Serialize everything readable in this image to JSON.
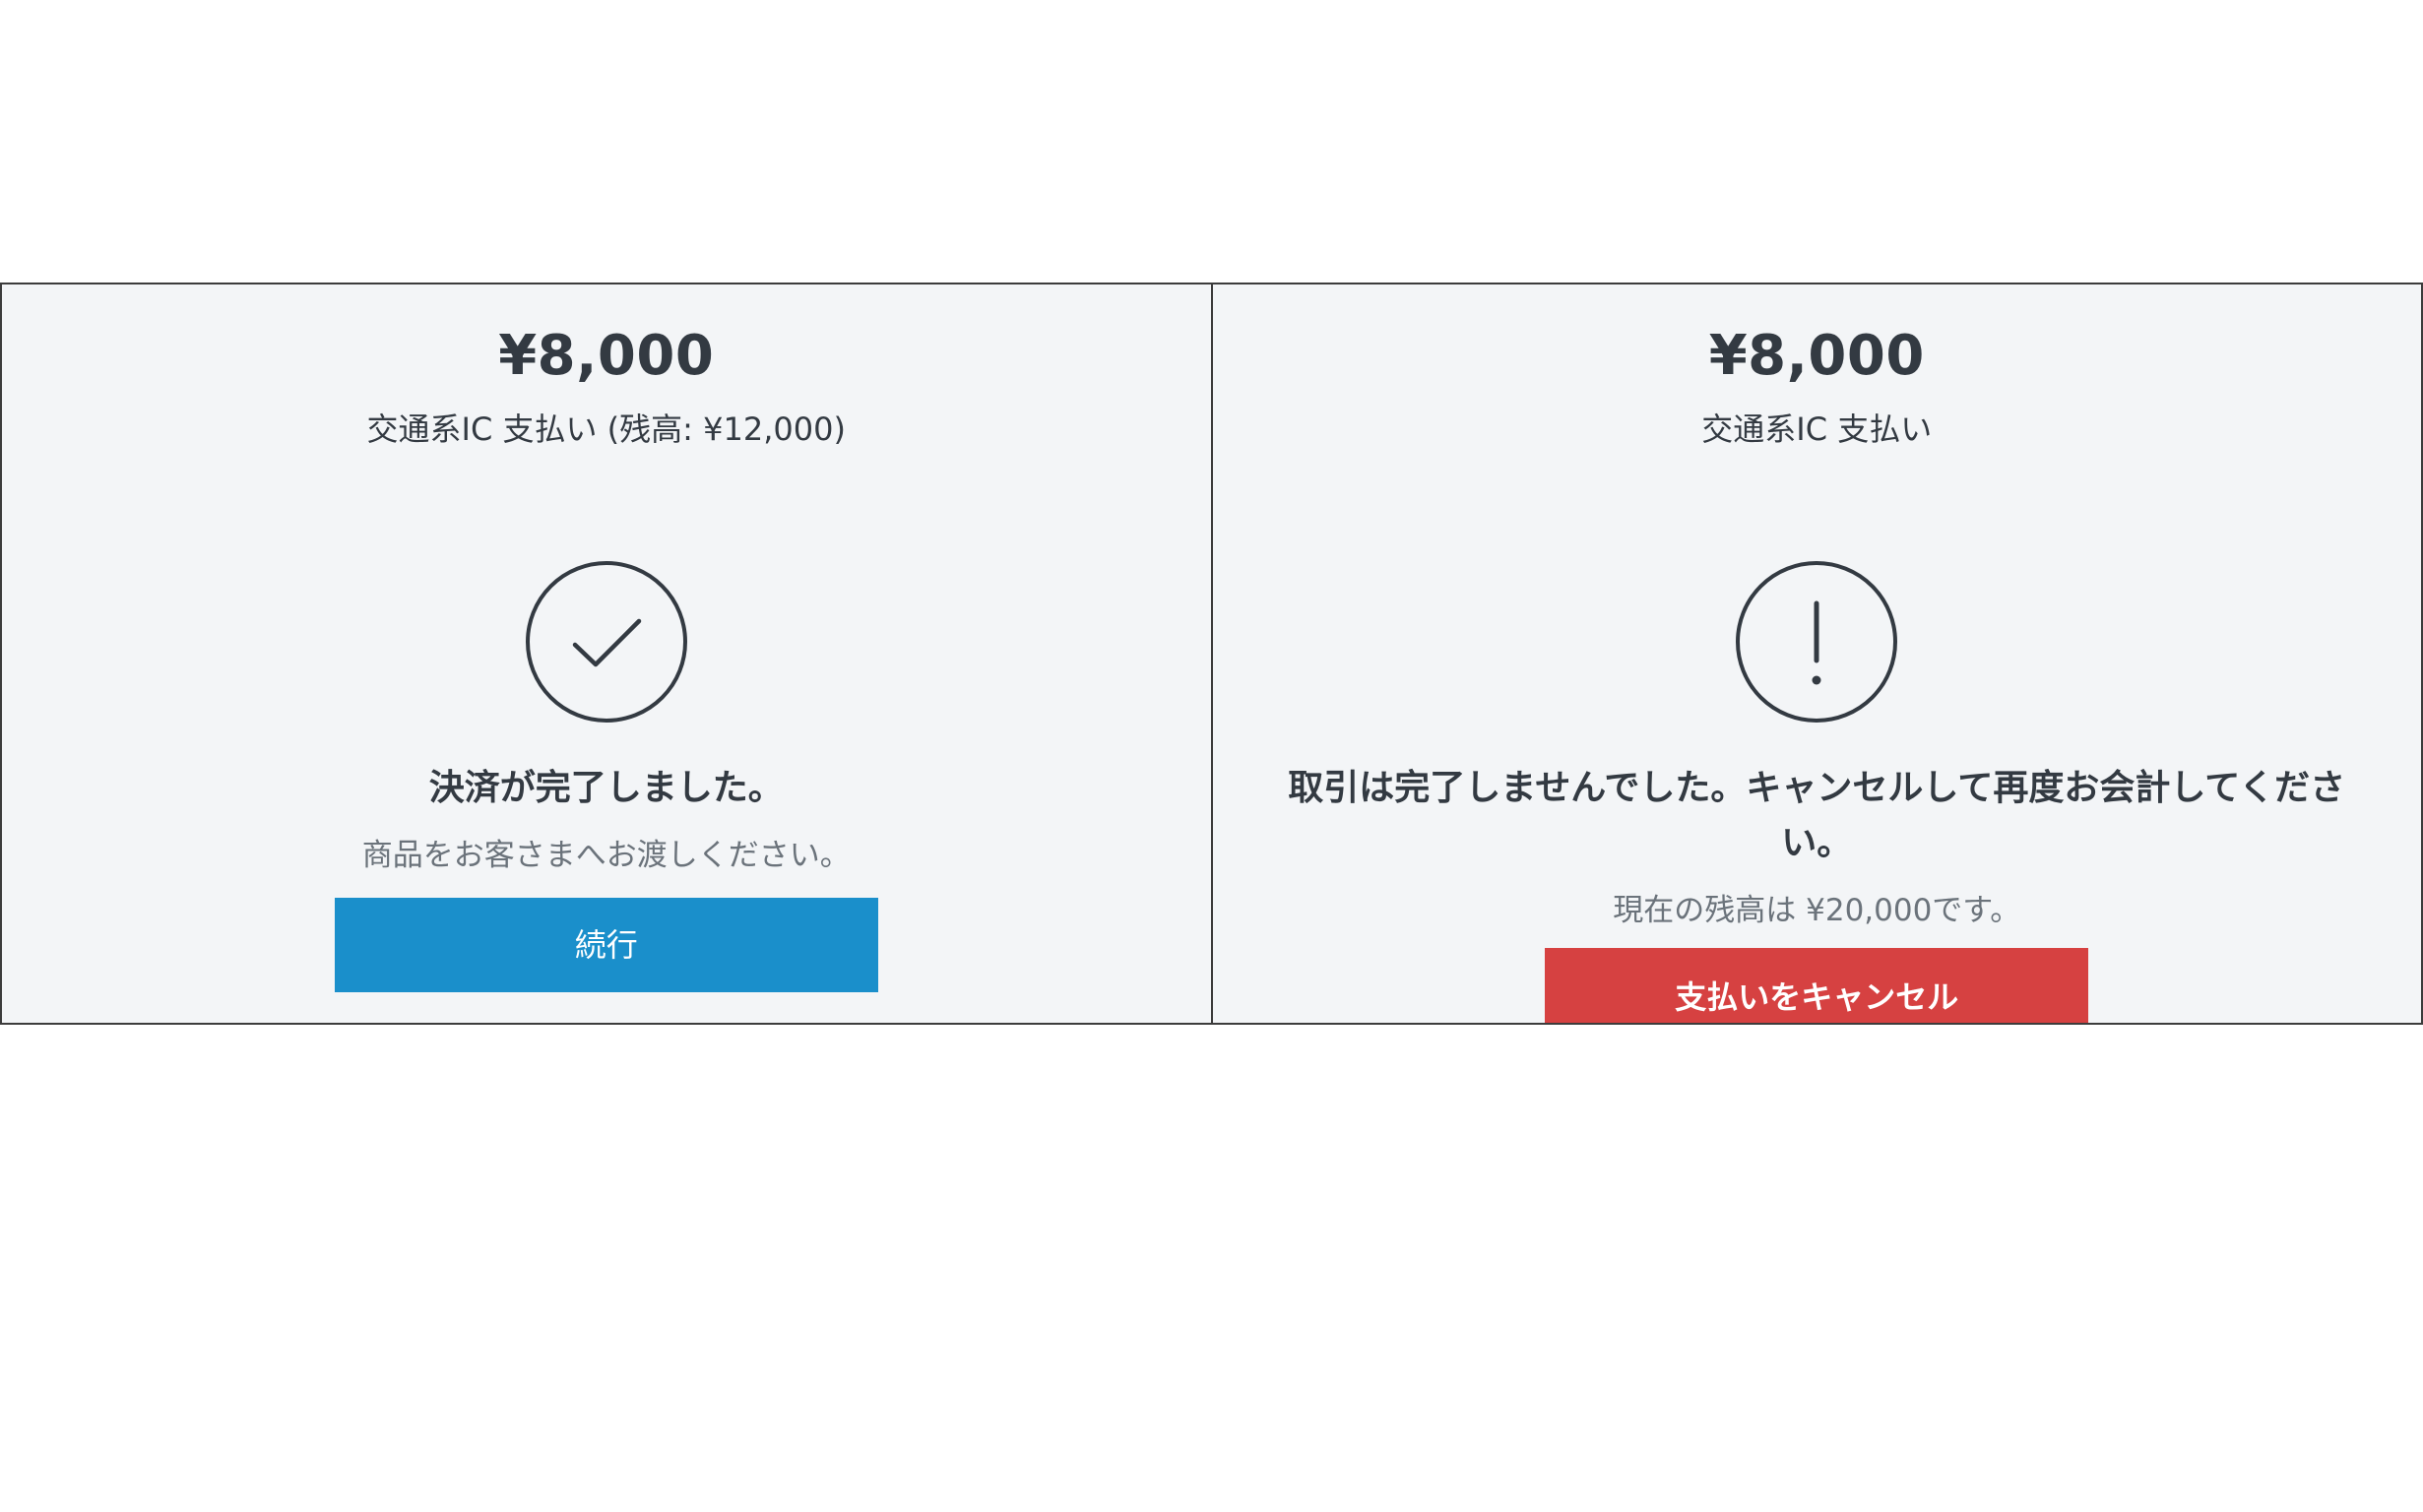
{
  "left_screen": {
    "amount": "¥8,000",
    "payment_method": "交通系IC 支払い (残高:  ¥12,000)",
    "status_icon": "check-circle-icon",
    "headline": "決済が完了しました。",
    "message": "商品をお客さまへお渡しください。",
    "button_label": "続行",
    "button_color": "#1a8fcb"
  },
  "right_screen": {
    "amount": "¥8,000",
    "payment_method": "交通系IC 支払い",
    "status_icon": "exclamation-circle-icon",
    "headline": "取引は完了しませんでした。キャンセルして再度お会計してください。",
    "message": "現在の残高は ¥20,000です。",
    "button_label": "支払いをキャンセル",
    "button_color": "#d64141"
  },
  "colors": {
    "panel_background": "#f3f5f7",
    "text_primary": "#333a42",
    "text_secondary": "#6b737b"
  }
}
